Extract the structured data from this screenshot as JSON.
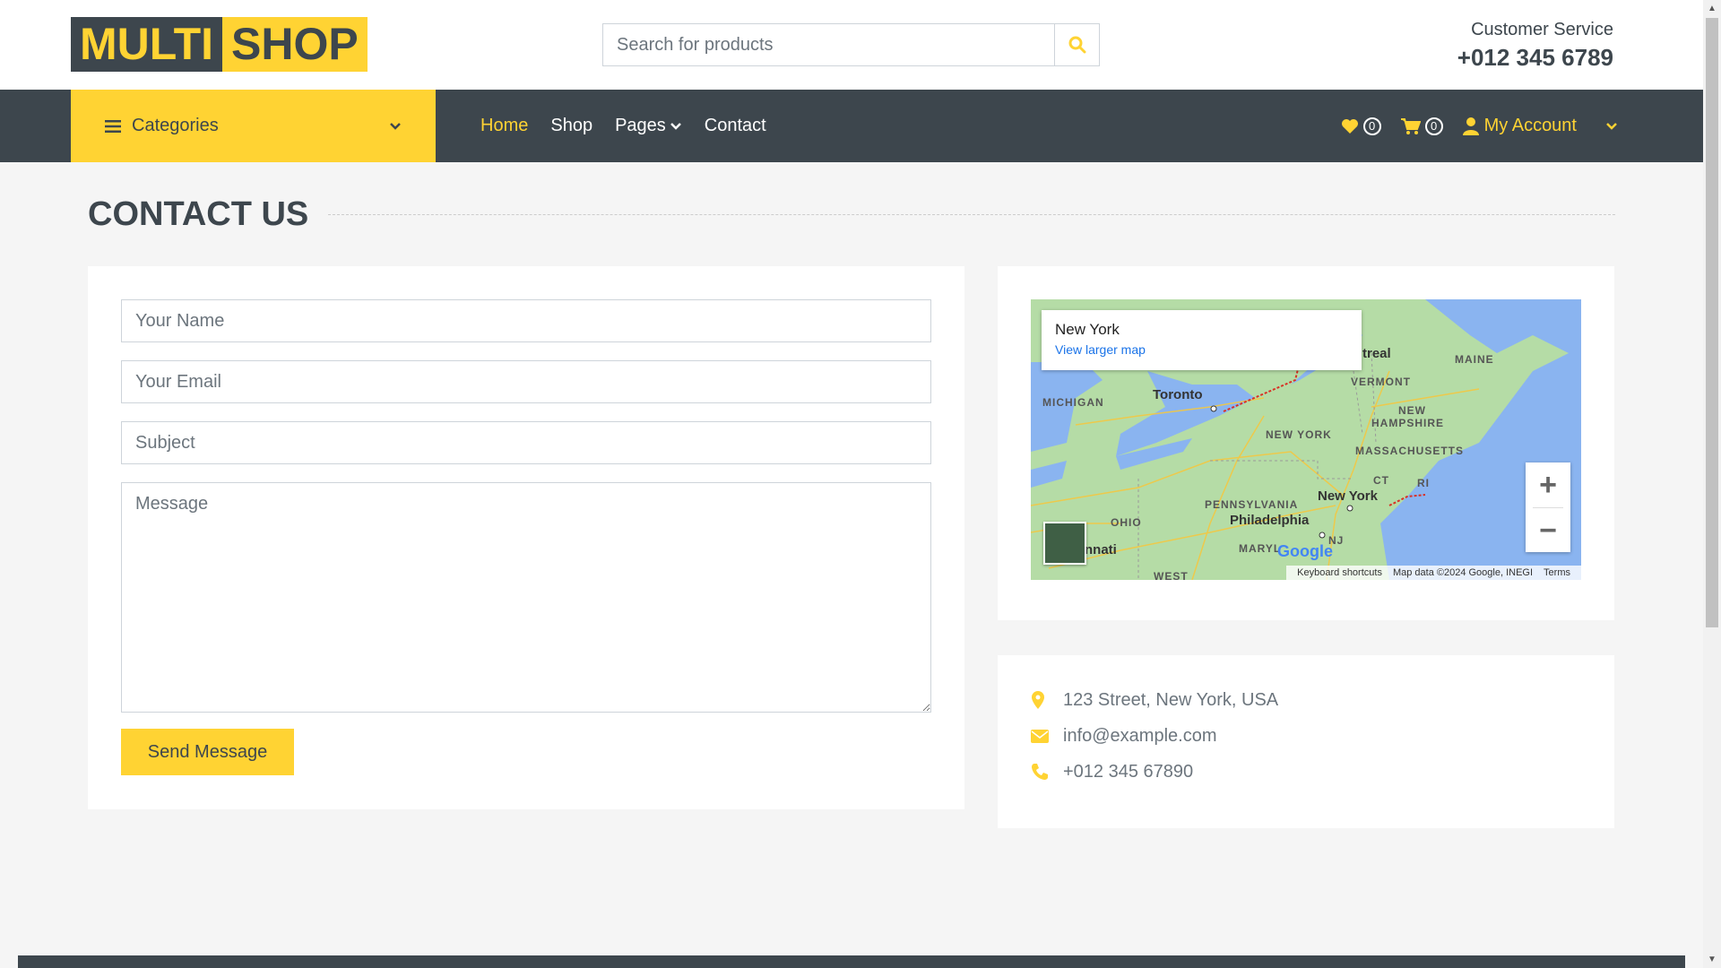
{
  "brand": {
    "part1": "MULTI",
    "part2": "SHOP"
  },
  "search": {
    "placeholder": "Search for products"
  },
  "customer_service": {
    "label": "Customer Service",
    "phone": "+012 345 6789"
  },
  "nav": {
    "categories_label": "Categories",
    "links": [
      "Home",
      "Shop",
      "Pages",
      "Contact"
    ],
    "active": "Home",
    "wishlist_count": "0",
    "cart_count": "0",
    "account_label": "My Account"
  },
  "page": {
    "title": "CONTACT US"
  },
  "form": {
    "name_placeholder": "Your Name",
    "email_placeholder": "Your Email",
    "subject_placeholder": "Subject",
    "message_placeholder": "Message",
    "submit_label": "Send Message"
  },
  "map": {
    "place": "New York",
    "view_larger": "View larger map",
    "labels": {
      "toronto": "Toronto",
      "montreal": "treal",
      "maine": "MAINE",
      "vermont": "VERMONT",
      "michigan": "MICHIGAN",
      "new_york_state": "NEW YORK",
      "new_hampshire_1": "NEW",
      "new_hampshire_2": "HAMPSHIRE",
      "massachusetts": "MASSACHUSETTS",
      "ct": "CT",
      "ri": "RI",
      "pennsylvania": "PENNSYLVANIA",
      "new_york_city": "New York",
      "philadelphia": "Philadelphia",
      "ohio": "OHIO",
      "cincinnati": "nnati",
      "maryland": "MARYL",
      "nj": "NJ",
      "west": "WEST"
    },
    "google": "Google",
    "attribution": [
      "Keyboard shortcuts",
      "Map data ©2024 Google, INEGI",
      "Terms"
    ],
    "zoom_in": "+",
    "zoom_out": "−"
  },
  "contact_info": {
    "address": "123 Street, New York, USA",
    "email": "info@example.com",
    "phone": "+012 345 67890"
  },
  "colors": {
    "accent": "#ffd333",
    "dark": "#3d464d",
    "muted": "#6c757d",
    "background": "#f5f5f5"
  }
}
